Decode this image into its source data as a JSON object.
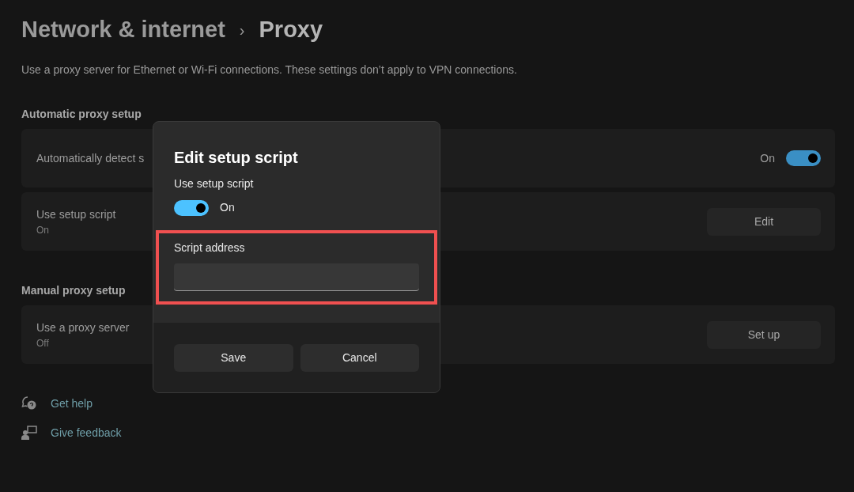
{
  "breadcrumb": {
    "parent": "Network & internet",
    "separator": "›",
    "current": "Proxy"
  },
  "description": "Use a proxy server for Ethernet or Wi-Fi connections. These settings don’t apply to VPN connections.",
  "sections": [
    {
      "heading": "Automatic proxy setup",
      "rows": [
        {
          "kind": "toggle",
          "title": "Automatically detect s",
          "on": true,
          "state_label": "On"
        },
        {
          "kind": "button",
          "title": "Use setup script",
          "subtitle": "On",
          "button": "Edit"
        }
      ]
    },
    {
      "heading": "Manual proxy setup",
      "rows": [
        {
          "kind": "button",
          "title": "Use a proxy server",
          "subtitle": "Off",
          "button": "Set up"
        }
      ]
    }
  ],
  "links": [
    {
      "kind": "help",
      "label": "Get help"
    },
    {
      "kind": "feedback",
      "label": "Give feedback"
    }
  ],
  "dialog": {
    "title": "Edit setup script",
    "toggle_label": "Use setup script",
    "toggle": {
      "on": true,
      "state_label": "On"
    },
    "field": {
      "label": "Script address",
      "highlighted": true
    },
    "buttons": [
      "Save",
      "Cancel"
    ]
  }
}
